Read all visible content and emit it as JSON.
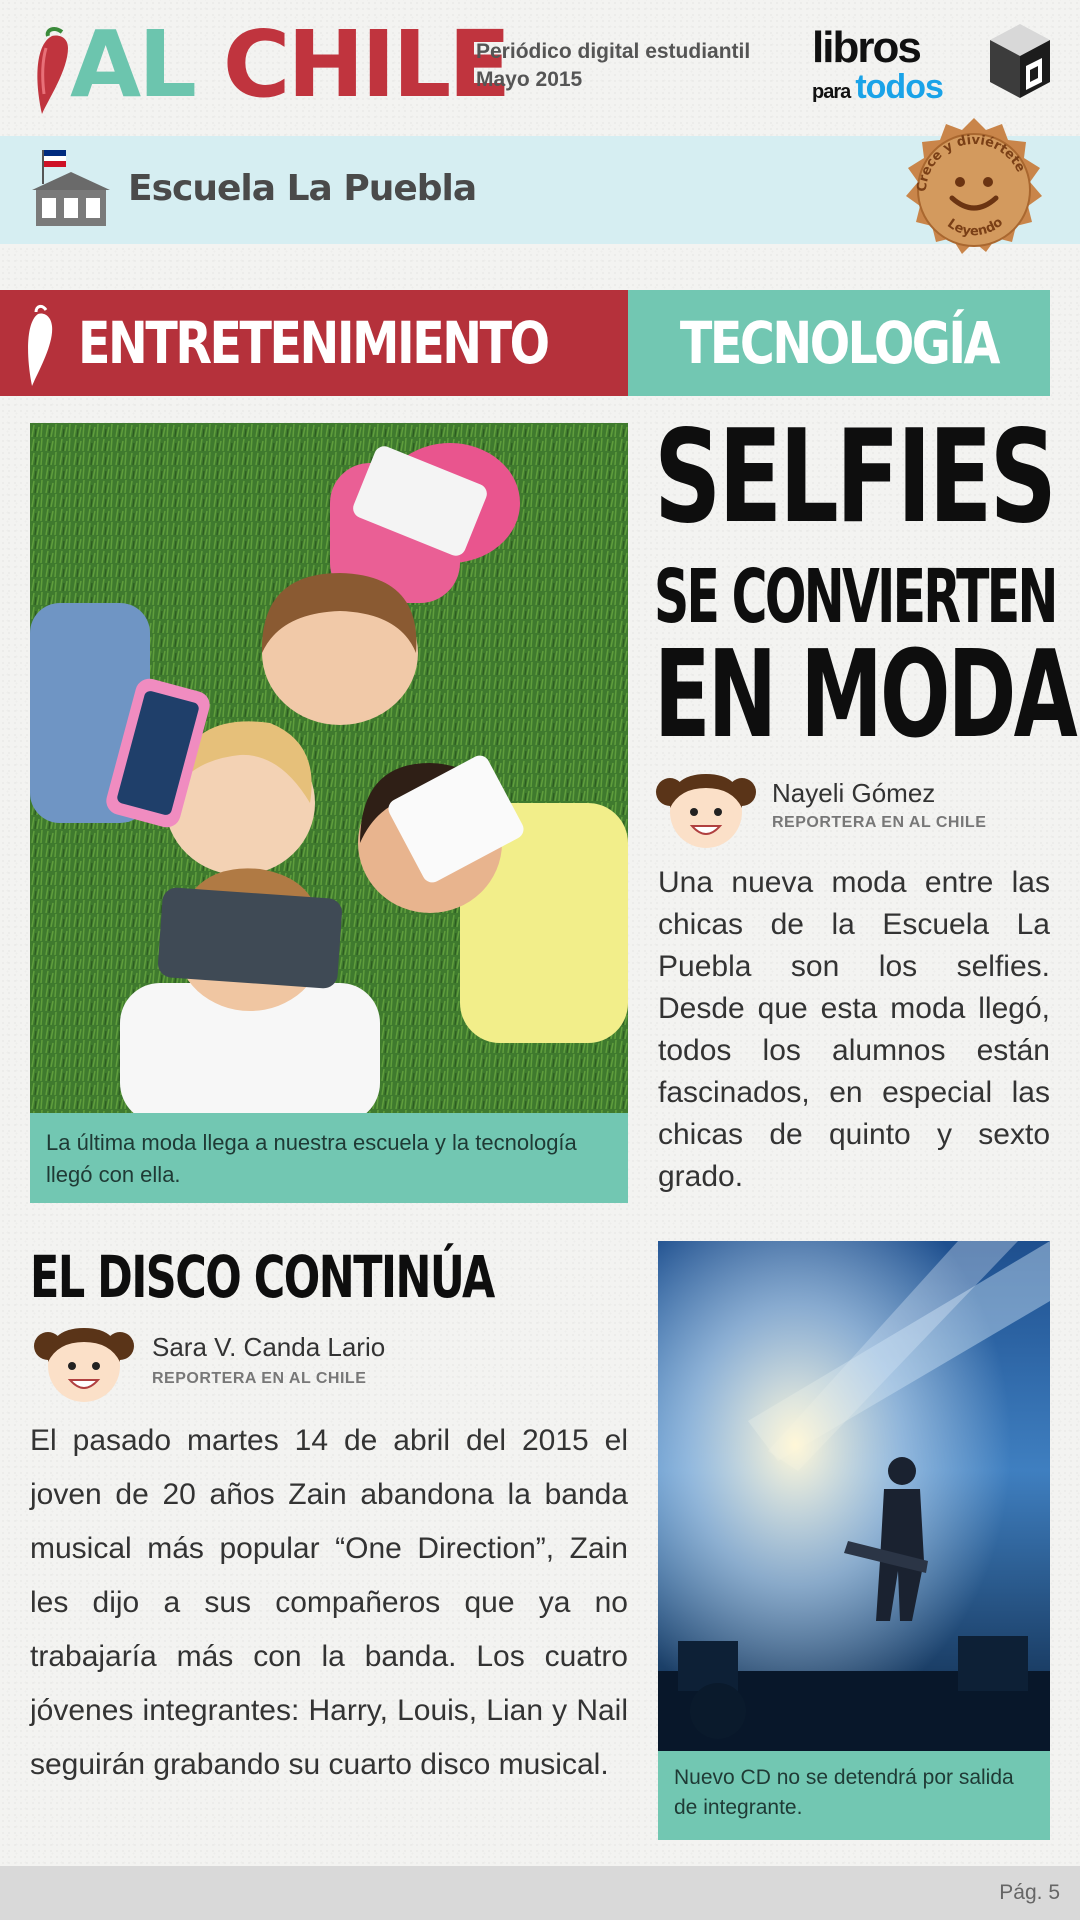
{
  "header": {
    "logo_al": "AL",
    "logo_chile": "CHILE",
    "publication_line": "Periódico digital estudiantil",
    "date_line": "Mayo 2015",
    "partner_logo": {
      "libros": "libros",
      "para": "para",
      "todos": "todos"
    }
  },
  "school": {
    "name": "Escuela La Puebla",
    "stamp_top": "Crece y diviértete",
    "stamp_bottom": "Leyendo"
  },
  "sections": {
    "left": "ENTRETENIMIENTO",
    "right": "TECNOLOGÍA"
  },
  "article1": {
    "headline_line1": "SELFIES",
    "headline_line2": "SE CONVIERTEN",
    "headline_line3": "EN MODA",
    "author": "Nayeli Gómez",
    "author_role": "REPORTERA EN AL CHILE",
    "photo_caption": "La última moda llega a nuestra escuela y la tecnología llegó con ella.",
    "body": "Una nueva moda entre las chicas de la Escuela La Puebla son los selfies. Desde que esta moda llegó, todos los alumnos están fascinados, en especial las chicas de quinto y sexto grado."
  },
  "article2": {
    "headline": "EL DISCO CONTINÚA",
    "author": "Sara V. Canda Lario",
    "author_role": "REPORTERA EN AL CHILE",
    "body": "El pasado martes 14 de abril del 2015 el joven de 20 años Zain abandona la banda musical más popular “One Direction”, Zain les dijo a sus compañeros que ya no trabajaría más con la banda. Los cuatro jóvenes integrantes: Harry, Louis, Lian y Nail seguirán grabando su cuarto disco musical.",
    "photo_caption": "Nuevo CD no se detendrá por salida de integrante."
  },
  "footer": {
    "page": "Pág. 5"
  },
  "colors": {
    "brand_red": "#b5313b",
    "brand_teal": "#72c7b2",
    "school_band": "#d6eef2"
  }
}
